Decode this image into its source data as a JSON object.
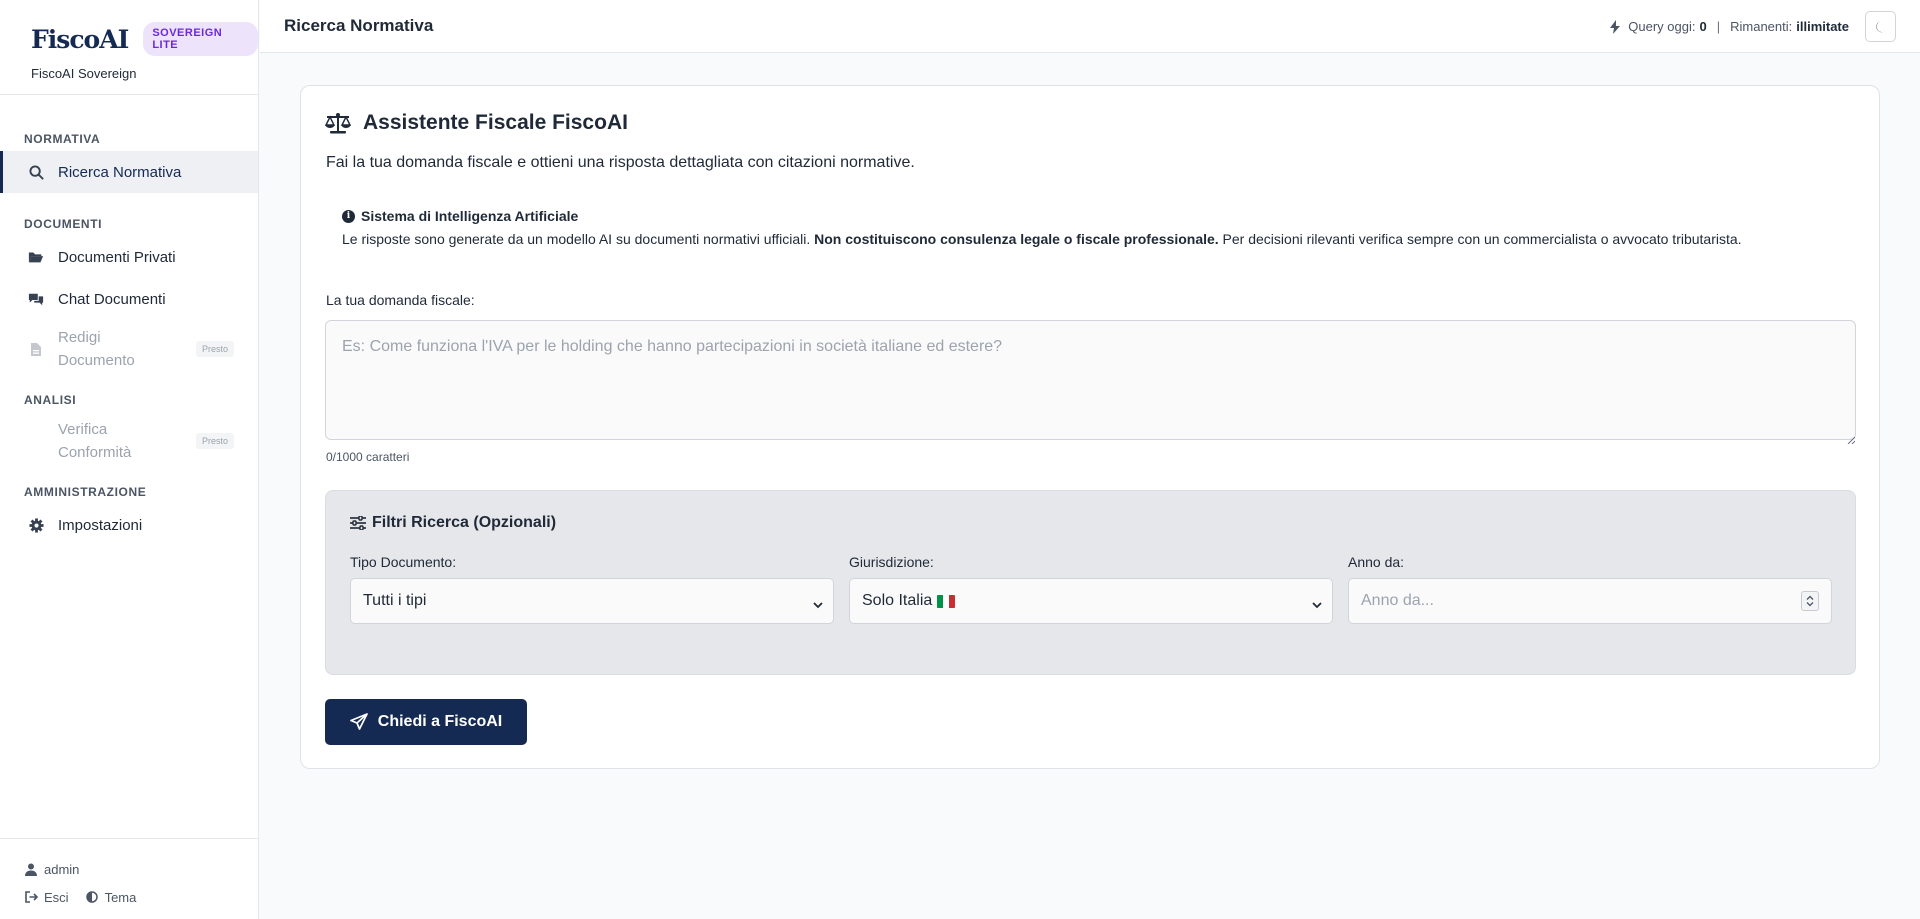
{
  "brand": {
    "logo": "FiscoAI",
    "badge": "SOVEREIGN LITE",
    "subtitle": "FiscoAI Sovereign"
  },
  "sidebar": {
    "sections": [
      {
        "label": "NORMATIVA"
      },
      {
        "label": "DOCUMENTI"
      },
      {
        "label": "ANALISI"
      },
      {
        "label": "AMMINISTRAZIONE"
      }
    ],
    "items": [
      {
        "label": "Ricerca Normativa",
        "icon": "search-icon"
      },
      {
        "label": "Documenti Privati",
        "icon": "folder-open-icon"
      },
      {
        "label": "Chat Documenti",
        "icon": "comments-icon"
      },
      {
        "label": "Redigi Documento",
        "icon": "file-icon",
        "tag": "Presto"
      },
      {
        "label": "Verifica Conformità",
        "tag": "Presto"
      },
      {
        "label": "Impostazioni",
        "icon": "gear-icon"
      }
    ],
    "footer": {
      "user": "admin",
      "logout": "Esci",
      "theme": "Tema"
    }
  },
  "topbar": {
    "title": "Ricerca Normativa",
    "query_label": "Query oggi:",
    "query_value": "0",
    "separator": "|",
    "remaining_label": "Rimanenti:",
    "remaining_value": "illimitate"
  },
  "main": {
    "title": "Assistente Fiscale FiscoAI",
    "lead": "Fai la tua domanda fiscale e ottieni una risposta dettagliata con citazioni normative.",
    "info": {
      "title": "Sistema di Intelligenza Artificiale",
      "text_before": "Le risposte sono generate da un modello AI su documenti normativi ufficiali. ",
      "text_bold": "Non costituiscono consulenza legale o fiscale professionale.",
      "text_after": " Per decisioni rilevanti verifica sempre con un commercialista o avvocato tributarista."
    },
    "question": {
      "label": "La tua domanda fiscale:",
      "placeholder": "Es: Come funziona l'IVA per le holding che hanno partecipazioni in società italiane ed estere?",
      "value": "",
      "counter": "0/1000 caratteri"
    },
    "filters": {
      "title": "Filtri Ricerca (Opzionali)",
      "doc_type": {
        "label": "Tipo Documento:",
        "value": "Tutti i tipi"
      },
      "jurisdiction": {
        "label": "Giurisdizione:",
        "value": "Solo Italia"
      },
      "year_from": {
        "label": "Anno da:",
        "placeholder": "Anno da..."
      }
    },
    "submit_label": "Chiedi a FiscoAI"
  },
  "colors": {
    "primary": "#152a53",
    "badge_bg": "#ede4fb",
    "badge_text": "#6d28d9",
    "filters_bg": "#e5e7eb"
  }
}
